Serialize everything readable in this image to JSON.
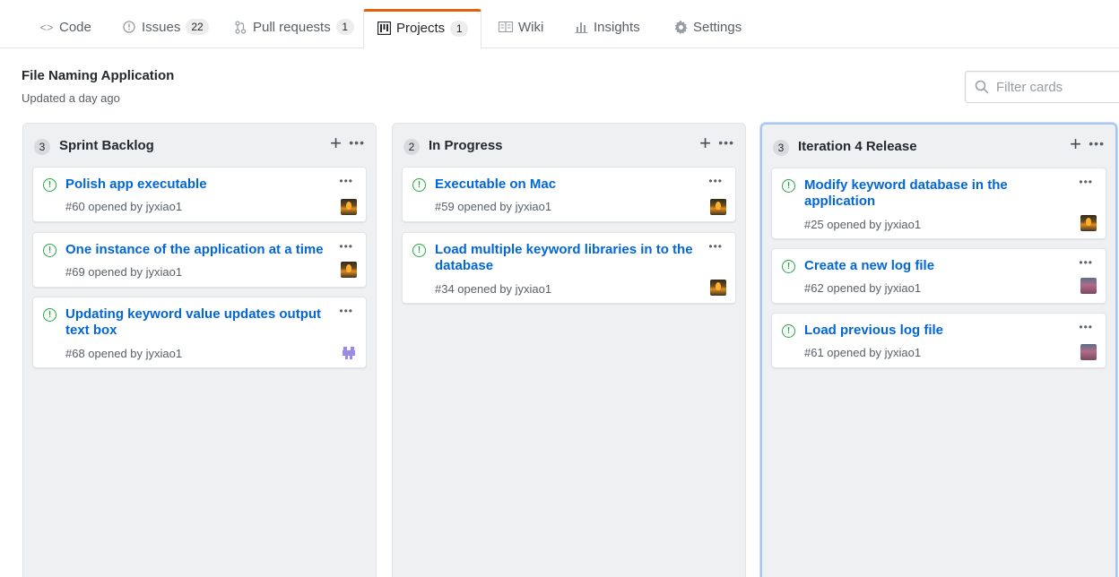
{
  "tabs": [
    {
      "label": "Code",
      "icon": "code-icon",
      "count": null
    },
    {
      "label": "Issues",
      "icon": "issue-icon",
      "count": "22"
    },
    {
      "label": "Pull requests",
      "icon": "pull-request-icon",
      "count": "1"
    },
    {
      "label": "Projects",
      "icon": "project-icon",
      "count": "1",
      "selected": true
    },
    {
      "label": "Wiki",
      "icon": "book-icon",
      "count": null
    },
    {
      "label": "Insights",
      "icon": "graph-icon",
      "count": null
    },
    {
      "label": "Settings",
      "icon": "gear-icon",
      "count": null
    }
  ],
  "project": {
    "title": "File Naming Application",
    "updated": "Updated a day ago"
  },
  "filter": {
    "placeholder": "Filter cards"
  },
  "columns": [
    {
      "count": "3",
      "name": "Sprint Backlog",
      "cards": [
        {
          "title": "Polish app executable",
          "meta": "#60 opened by jyxiao1",
          "avatar": "flame"
        },
        {
          "title": "One instance of the application at a time",
          "meta": "#69 opened by jyxiao1",
          "avatar": "flame"
        },
        {
          "title": "Updating keyword value updates output text box",
          "meta": "#68 opened by jyxiao1",
          "avatar": "identicon"
        }
      ]
    },
    {
      "count": "2",
      "name": "In Progress",
      "cards": [
        {
          "title": "Executable on Mac",
          "meta": "#59 opened by jyxiao1",
          "avatar": "flame"
        },
        {
          "title": "Load multiple keyword libraries in to the database",
          "meta": "#34 opened by jyxiao1",
          "avatar": "flame"
        }
      ]
    },
    {
      "count": "3",
      "name": "Iteration 4 Release",
      "cards": [
        {
          "title": "Modify keyword database in the application",
          "meta": "#25 opened by jyxiao1",
          "avatar": "flame"
        },
        {
          "title": "Create a new log file",
          "meta": "#62 opened by jyxiao1",
          "avatar": "person"
        },
        {
          "title": "Load previous log file",
          "meta": "#61 opened by jyxiao1",
          "avatar": "person"
        }
      ]
    }
  ],
  "colors": {
    "link": "#0366d6",
    "open_issue": "#28a745",
    "tab_accent": "#e36209",
    "column_bg": "#eff0f2",
    "focus_border": "#a6c8f0"
  }
}
